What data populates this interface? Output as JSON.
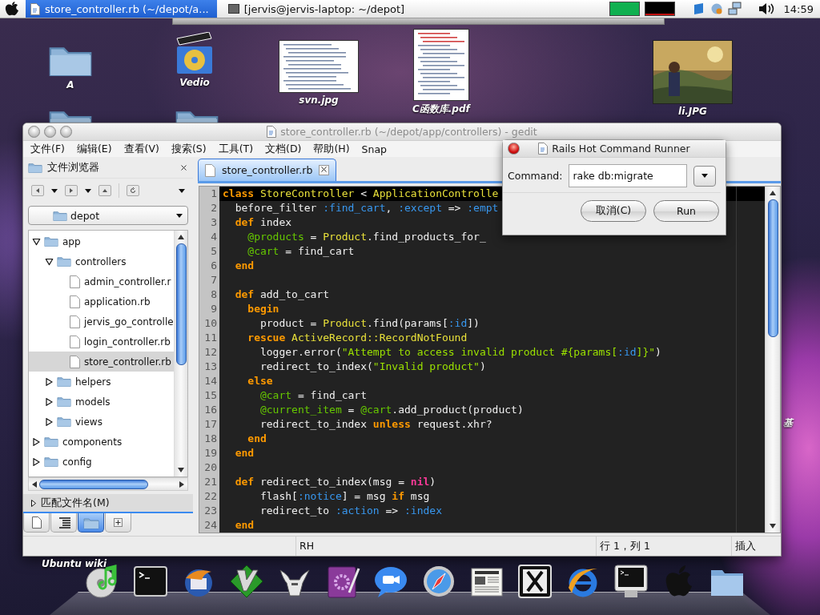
{
  "top_bar": {
    "tasks": [
      {
        "label": "store_controller.rb (~/depot/a...",
        "selected": true
      },
      {
        "label": "[jervis@jervis-laptop: ~/depot]",
        "selected": false
      }
    ],
    "clock": "14:59"
  },
  "desktop": {
    "icons": [
      {
        "label": "A",
        "kind": "folder"
      },
      {
        "label": "Vedio",
        "kind": "movie"
      },
      {
        "label": "svn.jpg",
        "kind": "document"
      },
      {
        "label": "C函数库.pdf",
        "kind": "document"
      },
      {
        "label": "li.JPG",
        "kind": "picture"
      },
      {
        "label": "基",
        "kind": "label"
      },
      {
        "label": "Ubuntu wiki",
        "kind": "label"
      }
    ]
  },
  "window": {
    "title": "store_controller.rb (~/depot/app/controllers) - gedit",
    "menu": [
      "文件(F)",
      "编辑(E)",
      "查看(V)",
      "搜索(S)",
      "工具(T)",
      "文档(D)",
      "帮助(H)",
      "Snap"
    ],
    "side_panel": {
      "title": "文件浏览器",
      "location": "depot",
      "tree": [
        {
          "label": "app",
          "kind": "folder",
          "expanded": true,
          "selected": false,
          "children": [
            {
              "label": "controllers",
              "kind": "folder",
              "expanded": true,
              "selected": false,
              "children": [
                {
                  "label": "admin_controller.r",
                  "kind": "file",
                  "selected": false
                },
                {
                  "label": "application.rb",
                  "kind": "file",
                  "selected": false
                },
                {
                  "label": "jervis_go_controlle",
                  "kind": "file",
                  "selected": false
                },
                {
                  "label": "login_controller.rb",
                  "kind": "file",
                  "selected": false
                },
                {
                  "label": "store_controller.rb",
                  "kind": "file",
                  "selected": true
                }
              ]
            },
            {
              "label": "helpers",
              "kind": "folder",
              "expanded": false,
              "selected": false
            },
            {
              "label": "models",
              "kind": "folder",
              "expanded": false,
              "selected": false
            },
            {
              "label": "views",
              "kind": "folder",
              "expanded": false,
              "selected": false
            }
          ]
        },
        {
          "label": "components",
          "kind": "folder",
          "expanded": false,
          "selected": false
        },
        {
          "label": "config",
          "kind": "folder",
          "expanded": false,
          "selected": false
        }
      ],
      "filter_label": "匹配文件名(M)",
      "filter_expanded": false,
      "tabs": [
        {
          "kind": "document",
          "selected": false
        },
        {
          "kind": "list",
          "selected": false
        },
        {
          "kind": "folder",
          "selected": true
        },
        {
          "kind": "plus",
          "selected": false
        }
      ]
    },
    "editor": {
      "tabs": [
        {
          "label": "store_controller.rb",
          "selected": true
        }
      ],
      "lines": [
        {
          "number": "1",
          "current": true,
          "tokens": [
            {
              "kind": "keyword",
              "text": "class"
            },
            {
              "kind": "constant",
              "text": " StoreController"
            },
            {
              "kind": "plain",
              "text": " < "
            },
            {
              "kind": "constant",
              "text": "ApplicationControlle"
            }
          ]
        },
        {
          "number": "2",
          "current": false,
          "tokens": [
            {
              "kind": "plain",
              "text": "  before_filter "
            },
            {
              "kind": "symbol",
              "text": ":find_cart"
            },
            {
              "kind": "plain",
              "text": ", "
            },
            {
              "kind": "symbol",
              "text": ":except"
            },
            {
              "kind": "plain",
              "text": " => "
            },
            {
              "kind": "symbol",
              "text": ":empt"
            }
          ]
        },
        {
          "number": "3",
          "current": false,
          "tokens": [
            {
              "kind": "keyword",
              "text": "  def"
            },
            {
              "kind": "plain",
              "text": " index"
            }
          ]
        },
        {
          "number": "4",
          "current": false,
          "tokens": [
            {
              "kind": "variable",
              "text": "    @products"
            },
            {
              "kind": "plain",
              "text": " = "
            },
            {
              "kind": "constant",
              "text": "Product"
            },
            {
              "kind": "plain",
              "text": ".find_products_for_"
            }
          ]
        },
        {
          "number": "5",
          "current": false,
          "tokens": [
            {
              "kind": "variable",
              "text": "    @cart"
            },
            {
              "kind": "plain",
              "text": " = find_cart"
            }
          ]
        },
        {
          "number": "6",
          "current": false,
          "tokens": [
            {
              "kind": "keyword",
              "text": "  end"
            }
          ]
        },
        {
          "number": "7",
          "current": false
        },
        {
          "number": "8",
          "current": false,
          "tokens": [
            {
              "kind": "keyword",
              "text": "  def"
            },
            {
              "kind": "plain",
              "text": " add_to_cart"
            }
          ]
        },
        {
          "number": "9",
          "current": false,
          "tokens": [
            {
              "kind": "keyword",
              "text": "    begin"
            }
          ]
        },
        {
          "number": "10",
          "current": false,
          "tokens": [
            {
              "kind": "plain",
              "text": "      product = "
            },
            {
              "kind": "constant",
              "text": "Product"
            },
            {
              "kind": "plain",
              "text": ".find(params["
            },
            {
              "kind": "symbol",
              "text": ":id"
            },
            {
              "kind": "plain",
              "text": "])"
            }
          ]
        },
        {
          "number": "11",
          "current": false,
          "tokens": [
            {
              "kind": "keyword",
              "text": "    rescue"
            },
            {
              "kind": "constant",
              "text": " ActiveRecord::RecordNotFound"
            }
          ]
        },
        {
          "number": "12",
          "current": false,
          "tokens": [
            {
              "kind": "plain",
              "text": "      logger.error("
            },
            {
              "kind": "string",
              "text": "\"Attempt to access invalid product #{params["
            },
            {
              "kind": "symbol",
              "text": ":id"
            },
            {
              "kind": "string",
              "text": "]}\""
            },
            {
              "kind": "plain",
              "text": ")"
            }
          ]
        },
        {
          "number": "13",
          "current": false,
          "tokens": [
            {
              "kind": "plain",
              "text": "      redirect_to_index("
            },
            {
              "kind": "string",
              "text": "\"Invalid product\""
            },
            {
              "kind": "plain",
              "text": ")"
            }
          ]
        },
        {
          "number": "14",
          "current": false,
          "tokens": [
            {
              "kind": "keyword",
              "text": "    else"
            }
          ]
        },
        {
          "number": "15",
          "current": false,
          "tokens": [
            {
              "kind": "variable",
              "text": "      @cart"
            },
            {
              "kind": "plain",
              "text": " = find_cart"
            }
          ]
        },
        {
          "number": "16",
          "current": false,
          "tokens": [
            {
              "kind": "variable",
              "text": "      @current_item"
            },
            {
              "kind": "plain",
              "text": " = "
            },
            {
              "kind": "variable",
              "text": "@cart"
            },
            {
              "kind": "plain",
              "text": ".add_product(product)"
            }
          ]
        },
        {
          "number": "17",
          "current": false,
          "tokens": [
            {
              "kind": "plain",
              "text": "      redirect_to_index "
            },
            {
              "kind": "keyword",
              "text": "unless"
            },
            {
              "kind": "plain",
              "text": " request.xhr?"
            }
          ]
        },
        {
          "number": "18",
          "current": false,
          "tokens": [
            {
              "kind": "keyword",
              "text": "    end"
            }
          ]
        },
        {
          "number": "19",
          "current": false,
          "tokens": [
            {
              "kind": "keyword",
              "text": "  end"
            }
          ]
        },
        {
          "number": "20",
          "current": false
        },
        {
          "number": "21",
          "current": false,
          "tokens": [
            {
              "kind": "keyword",
              "text": "  def"
            },
            {
              "kind": "plain",
              "text": " redirect_to_index(msg = "
            },
            {
              "kind": "nil",
              "text": "nil"
            },
            {
              "kind": "plain",
              "text": ")"
            }
          ]
        },
        {
          "number": "22",
          "current": false,
          "tokens": [
            {
              "kind": "plain",
              "text": "      flash["
            },
            {
              "kind": "symbol",
              "text": ":notice"
            },
            {
              "kind": "plain",
              "text": "] = msg "
            },
            {
              "kind": "keyword",
              "text": "if"
            },
            {
              "kind": "plain",
              "text": " msg"
            }
          ]
        },
        {
          "number": "23",
          "current": false,
          "tokens": [
            {
              "kind": "plain",
              "text": "      redirect_to "
            },
            {
              "kind": "symbol",
              "text": ":action"
            },
            {
              "kind": "plain",
              "text": " => "
            },
            {
              "kind": "symbol",
              "text": ":index"
            }
          ]
        },
        {
          "number": "24",
          "current": false,
          "tokens": [
            {
              "kind": "keyword",
              "text": "  end"
            }
          ]
        }
      ]
    },
    "status_bar": {
      "mode": "RH",
      "position": "行 1，列 1",
      "insert": "插入"
    }
  },
  "dialog": {
    "title": "Rails Hot Command Runner",
    "label": "Command:",
    "value": "rake db:migrate",
    "buttons": [
      "取消(C)",
      "Run"
    ]
  }
}
